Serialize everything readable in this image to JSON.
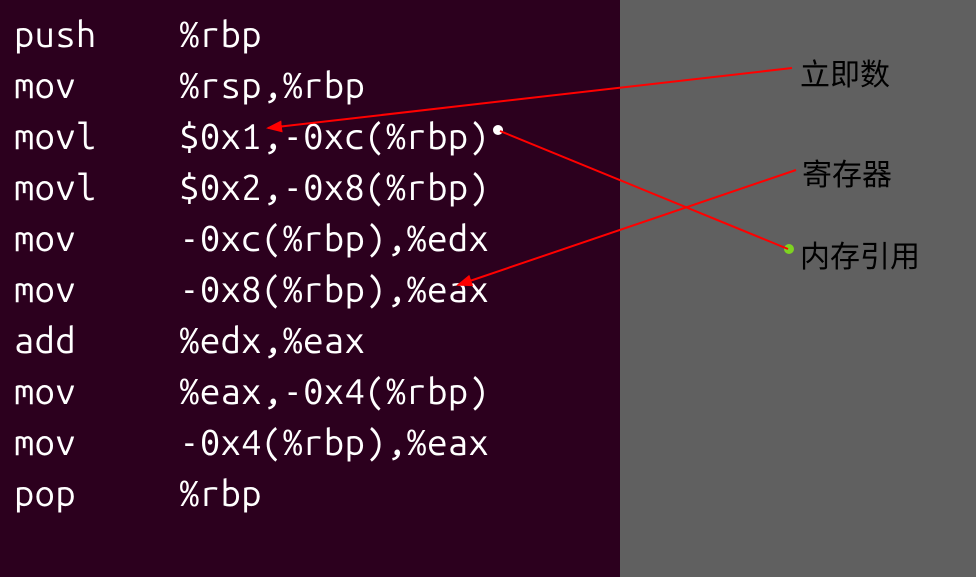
{
  "asm": {
    "lines": [
      {
        "mnemonic": "push",
        "operands": "%rbp"
      },
      {
        "mnemonic": "mov",
        "operands": "%rsp,%rbp"
      },
      {
        "mnemonic": "movl",
        "operands": "$0x1,-0xc(%rbp)"
      },
      {
        "mnemonic": "movl",
        "operands": "$0x2,-0x8(%rbp)"
      },
      {
        "mnemonic": "mov",
        "operands": "-0xc(%rbp),%edx"
      },
      {
        "mnemonic": "mov",
        "operands": "-0x8(%rbp),%eax"
      },
      {
        "mnemonic": "add",
        "operands": "%edx,%eax"
      },
      {
        "mnemonic": "mov",
        "operands": "%eax,-0x4(%rbp)"
      },
      {
        "mnemonic": "mov",
        "operands": "-0x4(%rbp),%eax"
      },
      {
        "mnemonic": "pop",
        "operands": "%rbp"
      }
    ]
  },
  "annotations": {
    "immediate": {
      "label": "立即数",
      "color": "#000000"
    },
    "register": {
      "label": "寄存器",
      "color": "#000000"
    },
    "memref": {
      "label": "内存引用",
      "color": "#000000"
    }
  },
  "dots": {
    "white": "#ffffff",
    "green": "#7ed321"
  },
  "arrow_color": "#ff0000"
}
